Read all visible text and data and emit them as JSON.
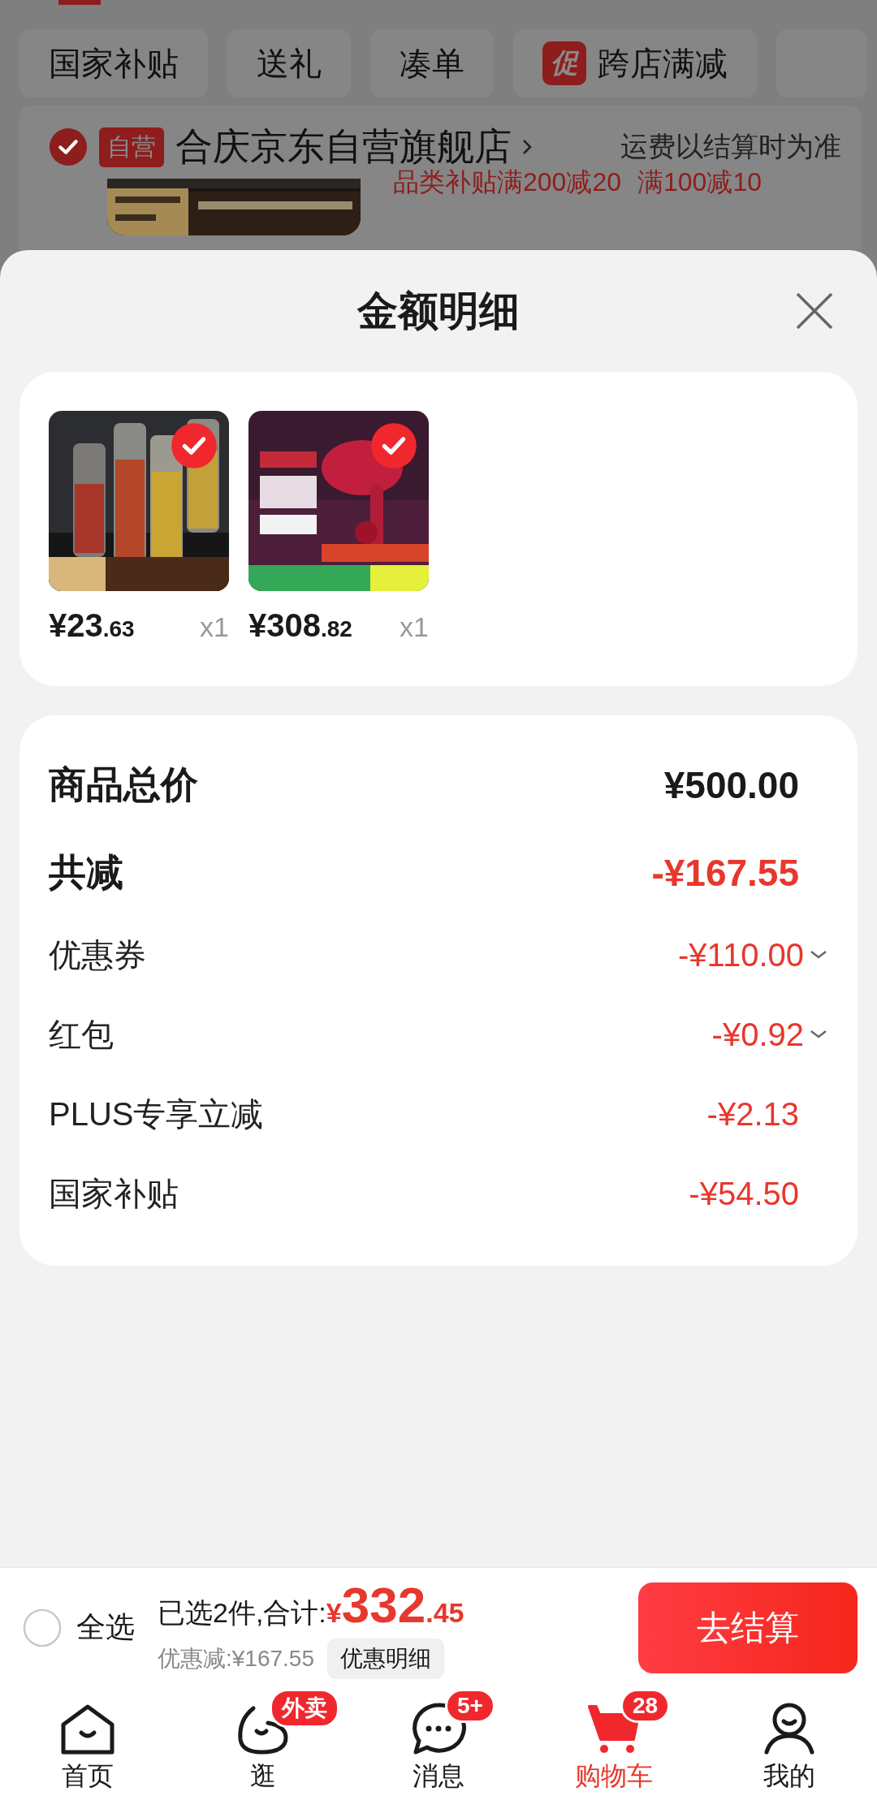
{
  "filter_chips": [
    {
      "label": "国家补贴"
    },
    {
      "label": "送礼"
    },
    {
      "label": "凑单"
    },
    {
      "label": "跨店满减",
      "tag": "促"
    }
  ],
  "shop": {
    "checked": true,
    "badge": "自营",
    "name": "合庆京东自营旗舰店",
    "shipping_note": "运费以结算时为准"
  },
  "promo_texts": [
    "品类补贴满200减20",
    "满100减10"
  ],
  "sheet": {
    "title": "金额明细",
    "items": [
      {
        "kind": "bottles",
        "price": "¥23",
        "price_decimal": ".63",
        "quantity": "x1",
        "checked": true
      },
      {
        "kind": "dryer",
        "price": "¥308",
        "price_decimal": ".82",
        "quantity": "x1",
        "checked": true
      }
    ],
    "rows": [
      {
        "kind": "subtotal",
        "label": "商品总价",
        "value": "¥500.00",
        "expandable": false
      },
      {
        "kind": "discount_total",
        "label": "共减",
        "value": "-¥167.55",
        "expandable": false
      },
      {
        "kind": "discount",
        "label": "优惠券",
        "value": "-¥110.00",
        "expandable": true
      },
      {
        "kind": "discount",
        "label": "红包",
        "value": "-¥0.92",
        "expandable": true
      },
      {
        "kind": "discount",
        "label": "PLUS专享立减",
        "value": "-¥2.13",
        "expandable": false
      },
      {
        "kind": "discount",
        "label": "国家补贴",
        "value": "-¥54.50",
        "expandable": false
      }
    ]
  },
  "checkout": {
    "select_all": {
      "label": "全选",
      "checked": false
    },
    "summary": "已选2件,合计:",
    "currency": "¥",
    "total": "332",
    "total_decimal": ".45",
    "discount": "优惠减:¥167.55",
    "detail_button": "优惠明细",
    "submit": "去结算"
  },
  "nav": [
    {
      "kind": "home",
      "label": "首页",
      "selected": false
    },
    {
      "kind": "blob",
      "label": "逛",
      "badge": "外卖",
      "selected": false
    },
    {
      "kind": "chat",
      "label": "消息",
      "badge": "5+",
      "selected": false
    },
    {
      "kind": "cart",
      "label": "购物车",
      "badge": "28",
      "selected": true
    },
    {
      "kind": "person",
      "label": "我的",
      "selected": false
    }
  ]
}
